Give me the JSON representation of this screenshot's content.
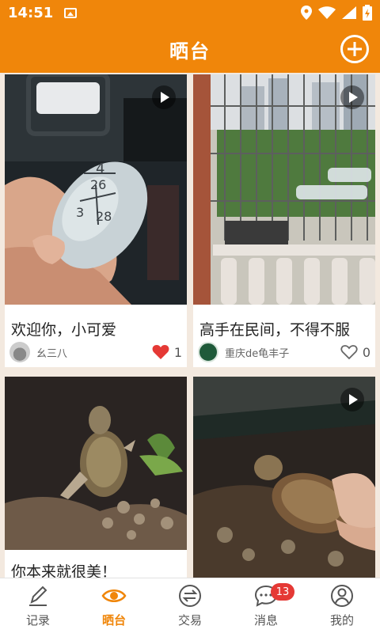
{
  "status_bar": {
    "time": "14:51"
  },
  "header": {
    "title": "晒台"
  },
  "posts": [
    {
      "title": "欢迎你，小可爱",
      "author": "幺三八",
      "likes": "1",
      "liked": true,
      "has_video": true,
      "image_desc": "hand holding egg marked 4-26 / 3-28"
    },
    {
      "title": "高手在民间，不得不服",
      "author": "重庆de龟丰子",
      "likes": "0",
      "liked": false,
      "has_video": true,
      "image_desc": "balcony with cage and bottles"
    },
    {
      "title": "你本来就很美！",
      "author": "",
      "likes": "",
      "liked": false,
      "has_video": false,
      "image_desc": "turtle in aquarium"
    },
    {
      "title": "",
      "author": "",
      "likes": "",
      "liked": false,
      "has_video": true,
      "image_desc": "hand holding turtle"
    }
  ],
  "tabs": [
    {
      "label": "记录",
      "icon": "pen-icon",
      "active": false
    },
    {
      "label": "晒台",
      "icon": "eye-icon",
      "active": true
    },
    {
      "label": "交易",
      "icon": "exchange-icon",
      "active": false
    },
    {
      "label": "消息",
      "icon": "chat-icon",
      "active": false,
      "badge": "13"
    },
    {
      "label": "我的",
      "icon": "user-icon",
      "active": false
    }
  ],
  "colors": {
    "accent": "#f0860a",
    "like": "#e53935",
    "badge": "#e53935"
  }
}
